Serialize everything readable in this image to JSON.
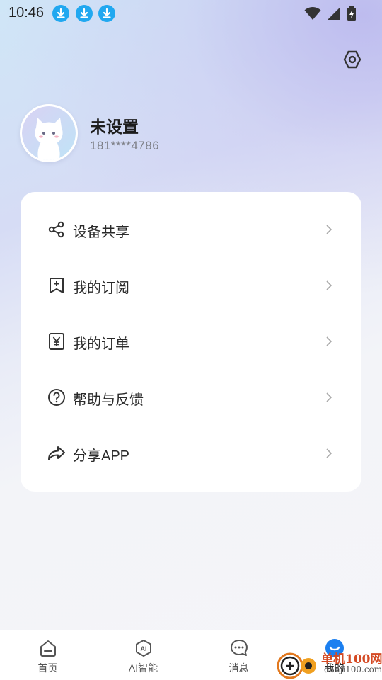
{
  "status_bar": {
    "time": "10:46",
    "download_icons": [
      "download-icon",
      "download-icon",
      "download-icon"
    ],
    "right_icons": [
      "wifi-icon",
      "signal-icon",
      "battery-charging-icon"
    ]
  },
  "header": {
    "settings_icon": "gear-icon"
  },
  "profile": {
    "name": "未设置",
    "phone": "181****4786",
    "avatar_icon": "cat-avatar-icon"
  },
  "menu": {
    "items": [
      {
        "label": "设备共享",
        "icon": "share-nodes-icon"
      },
      {
        "label": "我的订阅",
        "icon": "bookmark-plus-icon"
      },
      {
        "label": "我的订单",
        "icon": "yen-receipt-icon"
      },
      {
        "label": "帮助与反馈",
        "icon": "help-circle-icon"
      },
      {
        "label": "分享APP",
        "icon": "forward-arrow-icon"
      }
    ]
  },
  "tabs": [
    {
      "label": "首页",
      "icon": "home-icon",
      "active": false
    },
    {
      "label": "AI智能",
      "icon": "ai-hexagon-icon",
      "active": false
    },
    {
      "label": "消息",
      "icon": "message-icon",
      "active": false
    },
    {
      "label": "我的",
      "icon": "profile-smile-icon",
      "active": true
    }
  ],
  "colors": {
    "accent": "#1b7ff0",
    "text_primary": "#2a2a2a",
    "text_secondary": "#7d7f86",
    "download_badge": "#21a8f0"
  },
  "watermark": {
    "brand": "单机100网",
    "url": "danji100.com"
  }
}
